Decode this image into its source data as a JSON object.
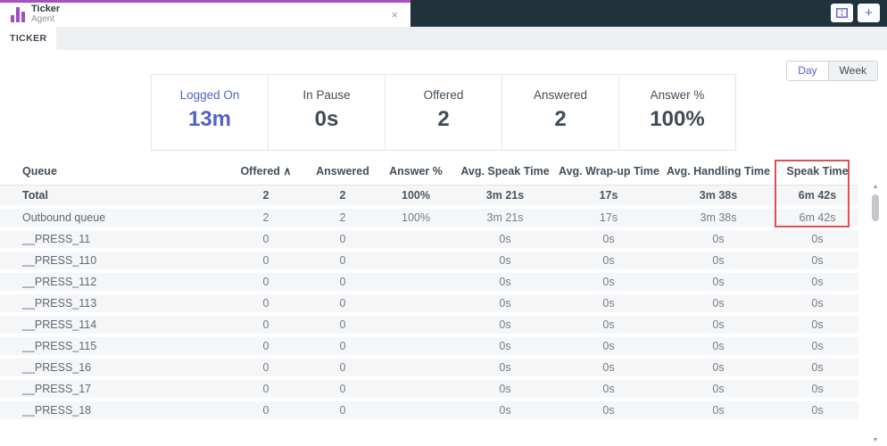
{
  "tab_bar": {
    "app_title": "Ticker",
    "app_subtitle": "Agent",
    "close_glyph": "×",
    "plus_glyph": "+"
  },
  "nav": {
    "ticker_tab_label": "TICKER"
  },
  "toolbar": {
    "day_label": "Day",
    "week_label": "Week",
    "selected": "Day"
  },
  "stats": {
    "cards": [
      {
        "label": "Logged On",
        "value": "13m",
        "highlighted": true
      },
      {
        "label": "In Pause",
        "value": "0s"
      },
      {
        "label": "Offered",
        "value": "2"
      },
      {
        "label": "Answered",
        "value": "2"
      },
      {
        "label": "Answer %",
        "value": "100%"
      }
    ]
  },
  "table": {
    "columns": [
      {
        "label": "Queue"
      },
      {
        "label": "Offered",
        "sort": "∧"
      },
      {
        "label": "Answered"
      },
      {
        "label": "Answer %"
      },
      {
        "label": "Avg. Speak Time"
      },
      {
        "label": "Avg. Wrap-up Time"
      },
      {
        "label": "Avg. Handling Time"
      },
      {
        "label": "Speak Time"
      }
    ],
    "rows": [
      {
        "bold": true,
        "cells": [
          "Total",
          "2",
          "2",
          "100%",
          "3m 21s",
          "17s",
          "3m 38s",
          "6m 42s"
        ]
      },
      {
        "bold": false,
        "cells": [
          "Outbound queue",
          "2",
          "2",
          "100%",
          "3m 21s",
          "17s",
          "3m 38s",
          "6m 42s"
        ]
      },
      {
        "bold": false,
        "cells": [
          "__PRESS_11",
          "0",
          "0",
          "",
          "0s",
          "0s",
          "0s",
          "0s"
        ]
      },
      {
        "bold": false,
        "cells": [
          "__PRESS_110",
          "0",
          "0",
          "",
          "0s",
          "0s",
          "0s",
          "0s"
        ]
      },
      {
        "bold": false,
        "cells": [
          "__PRESS_112",
          "0",
          "0",
          "",
          "0s",
          "0s",
          "0s",
          "0s"
        ]
      },
      {
        "bold": false,
        "cells": [
          "__PRESS_113",
          "0",
          "0",
          "",
          "0s",
          "0s",
          "0s",
          "0s"
        ]
      },
      {
        "bold": false,
        "cells": [
          "__PRESS_114",
          "0",
          "0",
          "",
          "0s",
          "0s",
          "0s",
          "0s"
        ]
      },
      {
        "bold": false,
        "cells": [
          "__PRESS_115",
          "0",
          "0",
          "",
          "0s",
          "0s",
          "0s",
          "0s"
        ]
      },
      {
        "bold": false,
        "cells": [
          "__PRESS_16",
          "0",
          "0",
          "",
          "0s",
          "0s",
          "0s",
          "0s"
        ]
      },
      {
        "bold": false,
        "cells": [
          "__PRESS_17",
          "0",
          "0",
          "",
          "0s",
          "0s",
          "0s",
          "0s"
        ]
      },
      {
        "bold": false,
        "cells": [
          "__PRESS_18",
          "0",
          "0",
          "",
          "0s",
          "0s",
          "0s",
          "0s"
        ]
      }
    ],
    "annotation_target": "Speak Time column"
  },
  "scrollbar": {
    "up_glyph": "▲",
    "down_glyph": "▼"
  },
  "colors": {
    "topbar_dark": "#20323b",
    "accent_purple": "#a94fc4",
    "accent_blue": "#5262ca",
    "annotation_red": "#e05050",
    "row_bg": "#f5f6f8"
  }
}
